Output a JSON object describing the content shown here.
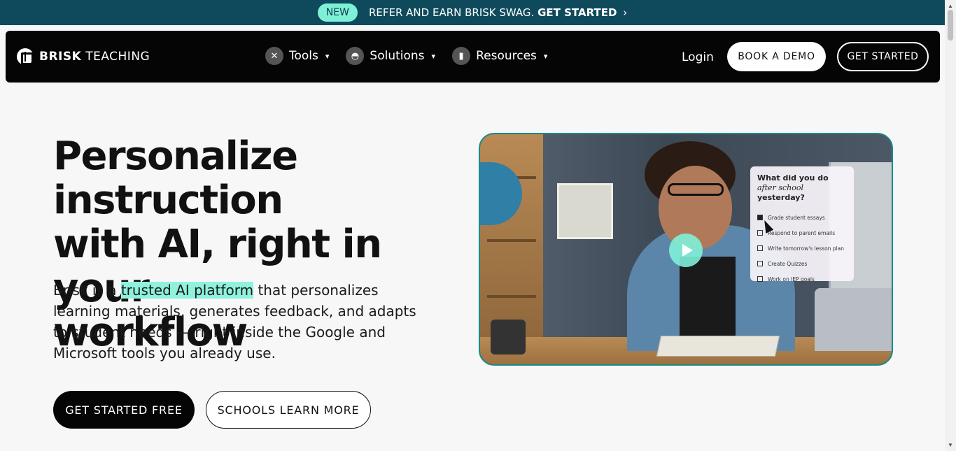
{
  "promo": {
    "badge": "NEW",
    "text": "REFER AND EARN BRISK SWAG.",
    "cta": "GET STARTED",
    "chevron_icon": "chevron-right-icon"
  },
  "nav": {
    "logo_bold": "BRISK",
    "logo_light": " TEACHING",
    "menu": [
      {
        "label": "Tools",
        "icon": "tools-icon"
      },
      {
        "label": "Solutions",
        "icon": "solutions-icon"
      },
      {
        "label": "Resources",
        "icon": "resources-icon"
      }
    ],
    "login": "Login",
    "demo_button": "BOOK A DEMO",
    "start_button": "GET STARTED"
  },
  "hero": {
    "title_line1": "Personalize instruction",
    "title_bold2": "with AI,",
    "title_rest2": " right in your",
    "title_line3": "workflow",
    "desc_before": "Brisk is a ",
    "desc_highlight": "trusted AI platform",
    "desc_after": " that personalizes learning materials, generates feedback, and adapts to student needs — right inside the Google and Microsoft tools you already use.",
    "primary_button": "GET STARTED FREE",
    "secondary_button": "SCHOOLS LEARN MORE"
  },
  "video": {
    "card_title_a": "What did you do ",
    "card_title_italic": "after school",
    "card_title_b": " yesterday?",
    "todos": [
      {
        "label": "Grade student essays",
        "checked": true
      },
      {
        "label": "Respond to parent emails",
        "checked": false
      },
      {
        "label": "Write tomorrow's lesson plan",
        "checked": false
      },
      {
        "label": "Create Quizzes",
        "checked": false
      },
      {
        "label": "Work on IEP goals",
        "checked": false
      }
    ]
  },
  "colors": {
    "promo_bg": "#0e4a5c",
    "accent_mint": "#7ff0d8",
    "nav_bg": "#050505",
    "video_border": "#1b8a8a"
  }
}
